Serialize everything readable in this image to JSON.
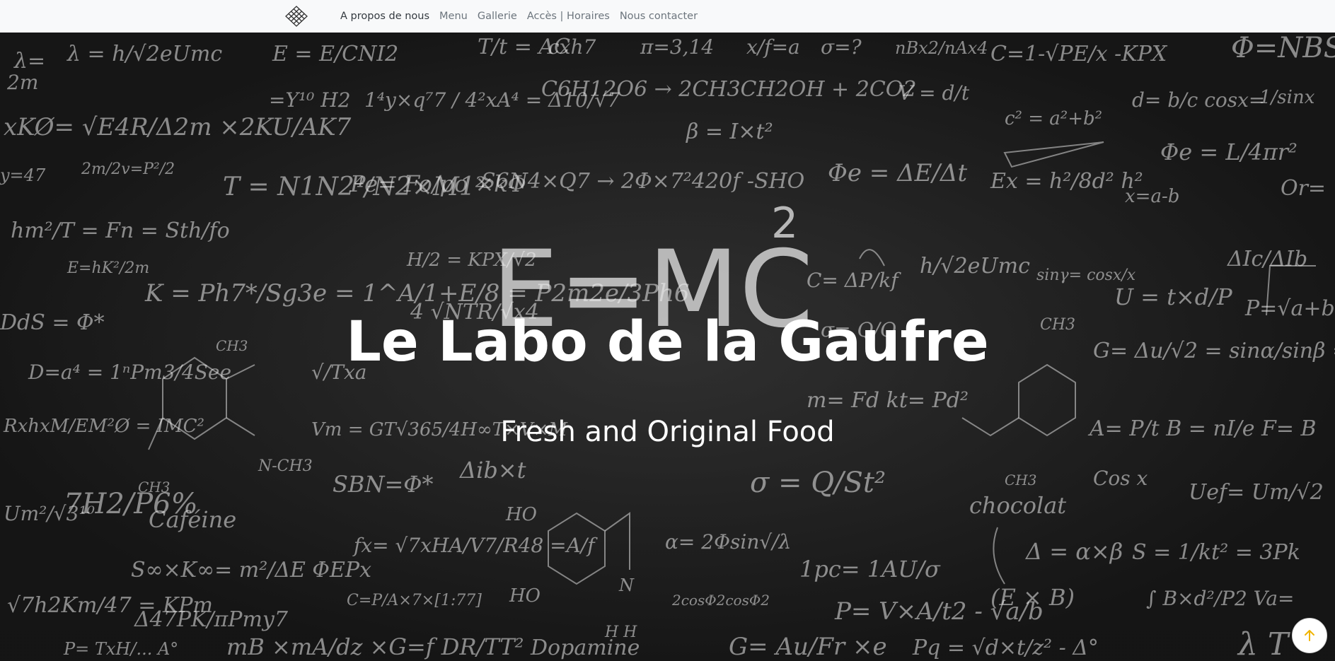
{
  "nav": {
    "logo_icon": "crosshatch-diamond-logo",
    "links": [
      {
        "label": "A propos de nous",
        "active": true
      },
      {
        "label": "Menu"
      },
      {
        "label": "Gallerie"
      },
      {
        "label": "Accès | Horaires"
      },
      {
        "label": "Nous contacter"
      }
    ]
  },
  "hero": {
    "title": "Le Labo de la Gaufre",
    "subtitle": "Fresh and Original Food",
    "background": "chalkboard-formulas-image"
  },
  "scroll_top": {
    "icon": "arrow-up-icon",
    "accent_color": "#f0b400"
  },
  "colors": {
    "navbar_bg": "#f8f9fa",
    "nav_text": "#6c757d",
    "nav_active": "#343a40",
    "hero_text": "#ffffff"
  }
}
